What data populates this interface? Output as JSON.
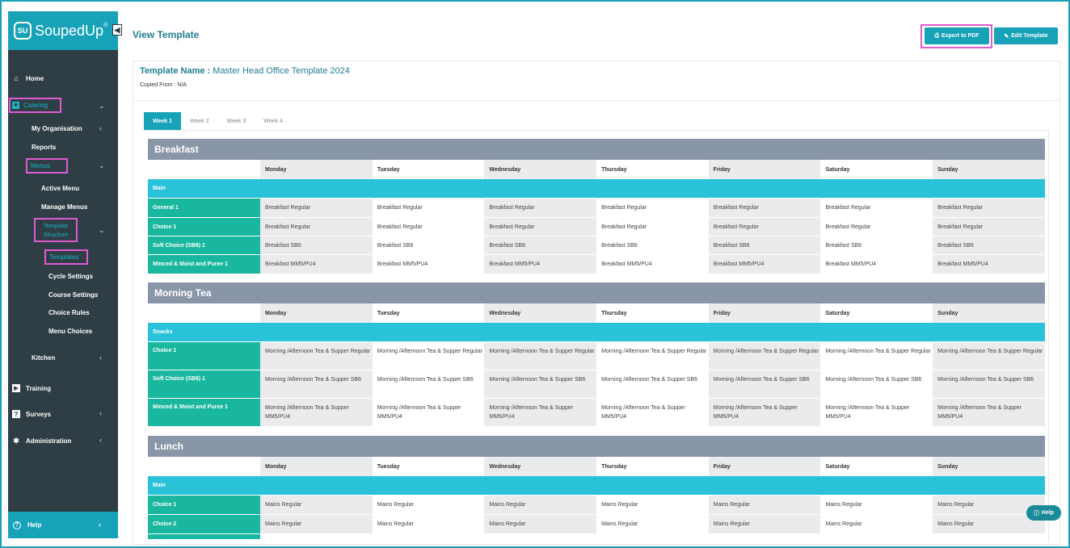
{
  "app": {
    "brand": "SoupedUp",
    "reg": "®",
    "logo_mark": "SU"
  },
  "page": {
    "title": "View Template"
  },
  "actions": {
    "export_pdf": "Export to PDF",
    "edit_template": "Edit Template"
  },
  "template": {
    "name_label": "Template Name :",
    "name_value": "Master Head Office Template 2024",
    "copied_from": "Copied From : N/A"
  },
  "tabs": [
    "Week 1",
    "Week 2",
    "Week 3",
    "Week 4"
  ],
  "days": [
    "Monday",
    "Tuesday",
    "Wednesday",
    "Thursday",
    "Friday",
    "Saturday",
    "Sunday"
  ],
  "sidebar": {
    "home": "Home",
    "catering": "Catering",
    "my_organisation": "My Organisation",
    "reports": "Reports",
    "menus": "Menus",
    "active_menu": "Active Menu",
    "manage_menus": "Manage Menus",
    "template_structure": "Template Structure",
    "templates": "Templates",
    "cycle_settings": "Cycle Settings",
    "course_settings": "Course Settings",
    "choice_rules": "Choice Rules",
    "menu_choices": "Menu Choices",
    "kitchen": "Kitchen",
    "training": "Training",
    "surveys": "Surveys",
    "administration": "Administration",
    "help": "Help"
  },
  "help_button": "Help",
  "sections": [
    {
      "title": "Breakfast",
      "category": "Main",
      "rows": [
        {
          "label": "General 1",
          "value": "Breakfast Regular"
        },
        {
          "label": "Choice 1",
          "value": "Breakfast Regular"
        },
        {
          "label": "Soft Choice (SB6) 1",
          "value": "Breakfast SB6"
        },
        {
          "label": "Minced & Moist and Puree 1",
          "value": "Breakfast MM5/PU4"
        }
      ]
    },
    {
      "title": "Morning Tea",
      "category": "Snacks",
      "rows": [
        {
          "label": "Choice 1",
          "value": "Morning /Afternoon Tea & Supper Regular"
        },
        {
          "label": "Soft Choice (SB6) 1",
          "value": "Morning /Afternoon Tea & Supper SB6"
        },
        {
          "label": "Minced & Moist and Puree 1",
          "value": "Morning /Afternoon Tea & Supper MM5/PU4"
        }
      ]
    },
    {
      "title": "Lunch",
      "category": "Main",
      "rows": [
        {
          "label": "Choice 1",
          "value": "Mains Regular"
        },
        {
          "label": "Choice 2",
          "value": "Mains Regular"
        }
      ]
    }
  ],
  "colors": {
    "accent": "#17a2b8",
    "sidebar": "#2f3d44",
    "section_header": "#8996a8",
    "category": "#29c2d9",
    "row_label": "#1ab79f",
    "highlight": "#e05ad3"
  }
}
